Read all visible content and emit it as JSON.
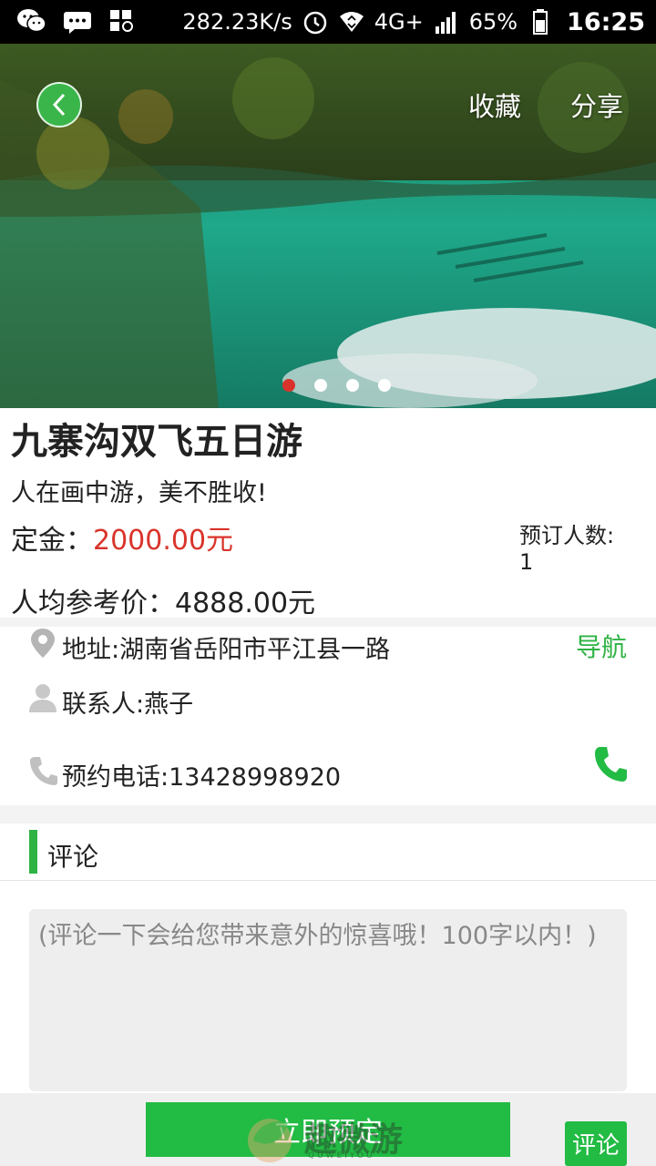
{
  "status_bar": {
    "net_speed": "282.23K/s",
    "network": "4G+",
    "battery": "65%",
    "time": "16:25"
  },
  "header": {
    "favorite_label": "收藏",
    "share_label": "分享"
  },
  "carousel": {
    "slide_count": 4,
    "active_index": 0
  },
  "tour": {
    "title": "九寨沟双飞五日游",
    "slogan": "人在画中游，美不胜收!",
    "deposit_label": "定金：",
    "deposit_value": "2000.00元",
    "booking_count_label": "预订人数:",
    "booking_count": "1",
    "ref_price_label": "人均参考价：",
    "ref_price_value": "4888.00元"
  },
  "contact": {
    "address": "地址:湖南省岳阳市平江县一路",
    "nav_label": "导航",
    "person": "联系人:燕子",
    "phone": "预约电话:13428998920"
  },
  "comments": {
    "section_title": "评论",
    "placeholder": "(评论一下会给您带来意外的惊喜哦！100字以内！)"
  },
  "bottom": {
    "book_label": "立即预定",
    "comment_label": "评论",
    "watermark_text": "趣微游",
    "watermark_sub": "QUWEIYOU"
  },
  "colors": {
    "accent_green": "#22bb44",
    "price_red": "#d9342b"
  }
}
